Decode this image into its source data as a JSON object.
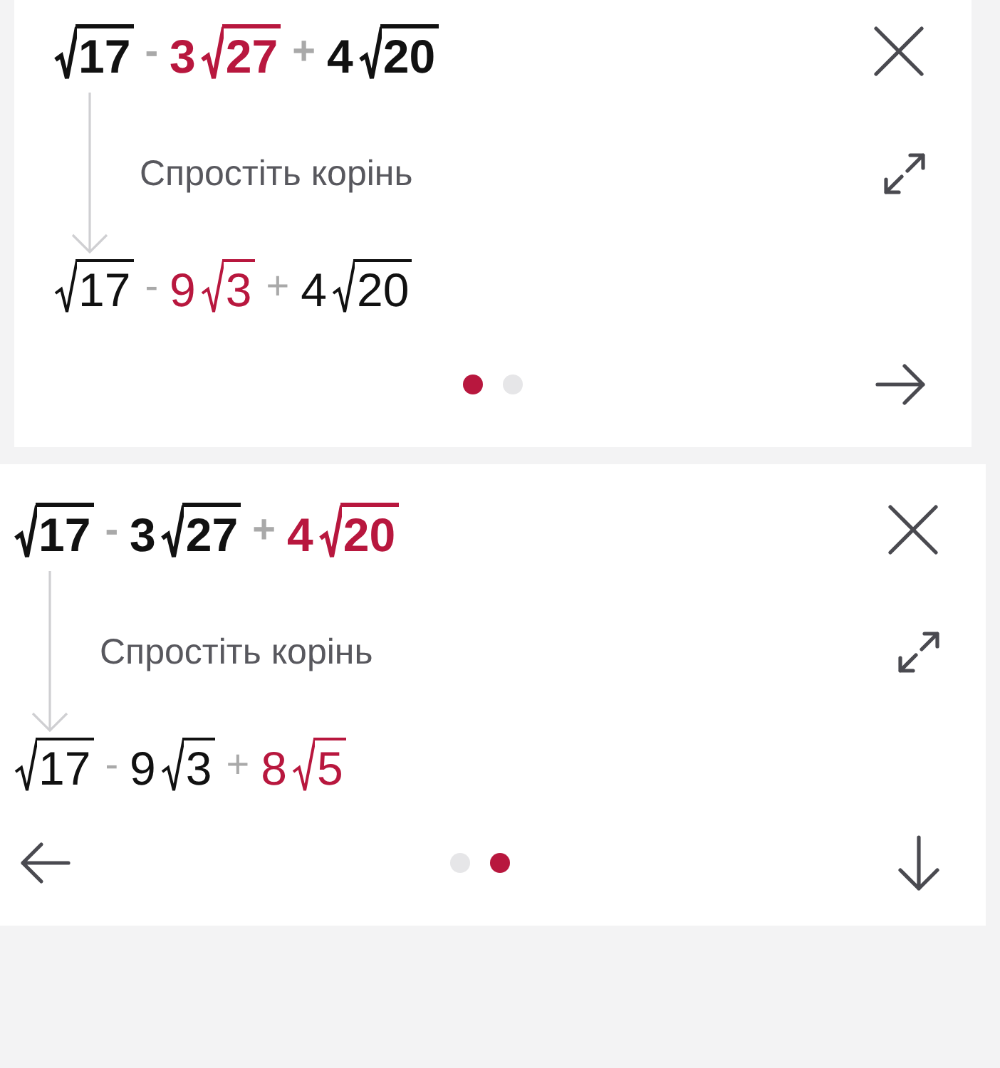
{
  "cards": [
    {
      "expression": [
        {
          "kind": "sqrt",
          "text": "17",
          "highlighted": false
        },
        {
          "kind": "op",
          "text": "-",
          "highlighted": false
        },
        {
          "kind": "num",
          "text": "3",
          "highlighted": true
        },
        {
          "kind": "sqrt",
          "text": "27",
          "highlighted": true
        },
        {
          "kind": "op",
          "text": "+",
          "highlighted": false
        },
        {
          "kind": "num",
          "text": "4",
          "highlighted": false
        },
        {
          "kind": "sqrt",
          "text": "20",
          "highlighted": false
        }
      ],
      "step": "Спростіть корінь",
      "result": [
        {
          "kind": "sqrt",
          "text": "17",
          "highlighted": false
        },
        {
          "kind": "op",
          "text": "-",
          "highlighted": false
        },
        {
          "kind": "num",
          "text": "9",
          "highlighted": true
        },
        {
          "kind": "sqrt",
          "text": "3",
          "highlighted": true
        },
        {
          "kind": "op",
          "text": "+",
          "highlighted": false
        },
        {
          "kind": "num",
          "text": "4",
          "highlighted": false
        },
        {
          "kind": "sqrt",
          "text": "20",
          "highlighted": false
        }
      ],
      "dots": [
        {
          "selected": true
        },
        {
          "selected": false
        }
      ],
      "buttons": [
        {
          "kind": "next"
        }
      ]
    },
    {
      "expression": [
        {
          "kind": "sqrt",
          "text": "17",
          "highlighted": false
        },
        {
          "kind": "op",
          "text": "-",
          "highlighted": false
        },
        {
          "kind": "num",
          "text": "3",
          "highlighted": false
        },
        {
          "kind": "sqrt",
          "text": "27",
          "highlighted": false
        },
        {
          "kind": "op",
          "text": "+",
          "highlighted": false
        },
        {
          "kind": "num",
          "text": "4",
          "highlighted": true
        },
        {
          "kind": "sqrt",
          "text": "20",
          "highlighted": true
        }
      ],
      "step": "Спростіть корінь",
      "result": [
        {
          "kind": "sqrt",
          "text": "17",
          "highlighted": false
        },
        {
          "kind": "op",
          "text": "-",
          "highlighted": false
        },
        {
          "kind": "num",
          "text": "9",
          "highlighted": false
        },
        {
          "kind": "sqrt",
          "text": "3",
          "highlighted": false
        },
        {
          "kind": "op",
          "text": "+",
          "highlighted": false
        },
        {
          "kind": "num",
          "text": "8",
          "highlighted": true
        },
        {
          "kind": "sqrt",
          "text": "5",
          "highlighted": true
        }
      ],
      "dots": [
        {
          "selected": false
        },
        {
          "selected": true
        }
      ],
      "buttons": [
        {
          "kind": "back"
        },
        {
          "kind": "down"
        }
      ]
    }
  ]
}
